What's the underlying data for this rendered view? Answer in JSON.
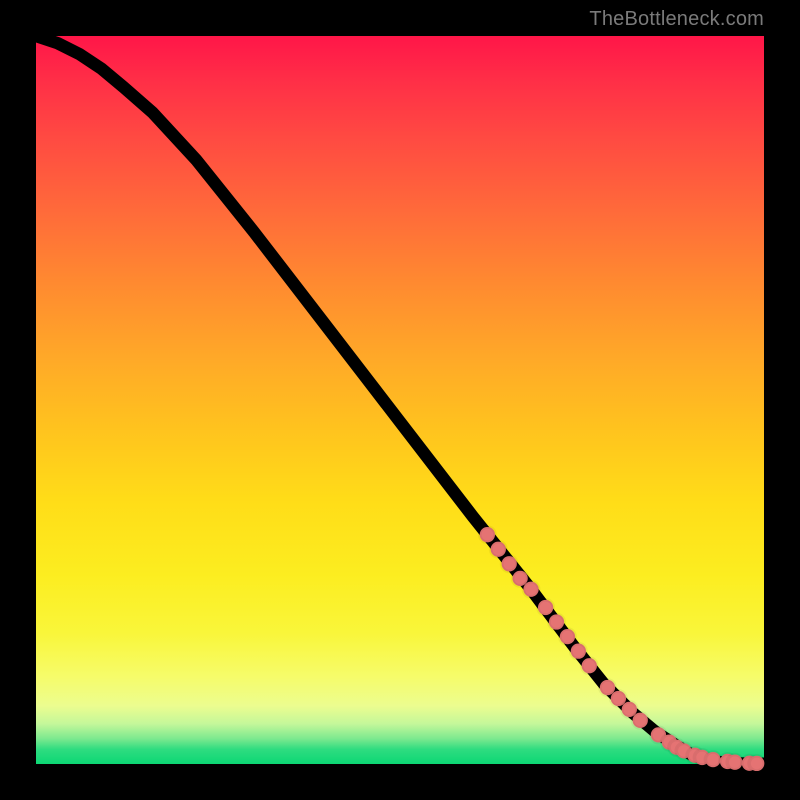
{
  "watermark": "TheBottleneck.com",
  "colors": {
    "page_bg": "#000000",
    "marker_fill": "#e57373",
    "curve_stroke": "#000000"
  },
  "chart_data": {
    "type": "line",
    "title": "",
    "xlabel": "",
    "ylabel": "",
    "xlim": [
      0,
      100
    ],
    "ylim": [
      0,
      100
    ],
    "grid": false,
    "series": [
      {
        "name": "bottleneck-curve",
        "x": [
          0,
          3,
          6,
          9,
          12,
          16,
          22,
          30,
          40,
          50,
          60,
          68,
          74,
          78,
          82,
          85,
          88,
          90,
          92,
          94,
          96,
          98,
          100
        ],
        "y": [
          100,
          99,
          97.5,
          95.5,
          93,
          89.5,
          83,
          73,
          60,
          47,
          34,
          24,
          16,
          11,
          7,
          4.5,
          2.5,
          1.3,
          0.6,
          0.25,
          0.1,
          0.05,
          0.05
        ]
      }
    ],
    "markers": {
      "name": "highlighted-points",
      "x": [
        62,
        63.5,
        65,
        66.5,
        68,
        70,
        71.5,
        73,
        74.5,
        76,
        78.5,
        80,
        81.5,
        83,
        85.5,
        87,
        88,
        89,
        90.5,
        91.5,
        93,
        95,
        96,
        98,
        99
      ],
      "y": [
        31.5,
        29.5,
        27.5,
        25.5,
        24,
        21.5,
        19.5,
        17.5,
        15.5,
        13.5,
        10.5,
        9,
        7.5,
        6,
        4,
        3,
        2.3,
        1.8,
        1.2,
        0.9,
        0.6,
        0.35,
        0.25,
        0.1,
        0.08
      ]
    }
  }
}
